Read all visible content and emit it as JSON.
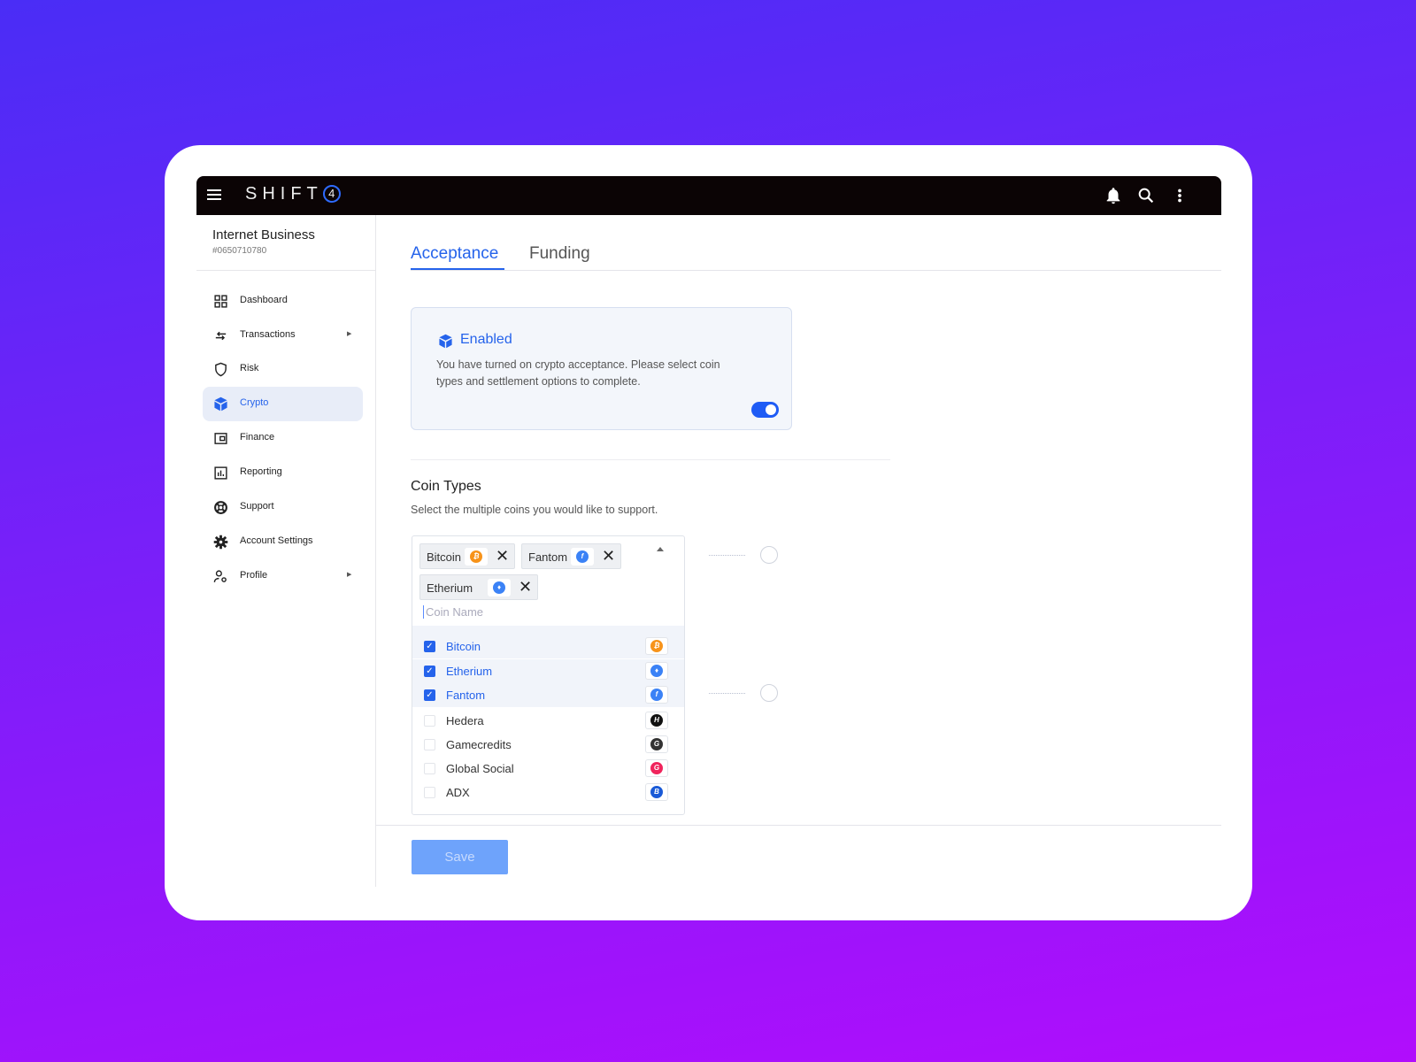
{
  "app": {
    "brand": "SHIFT",
    "brand_mark": "4"
  },
  "account": {
    "name": "Internet Business",
    "id": "#0650710780"
  },
  "sidebar": {
    "items": [
      {
        "label": "Dashboard",
        "icon": "grid-icon"
      },
      {
        "label": "Transactions",
        "icon": "arrows-icon",
        "has_submenu": true
      },
      {
        "label": "Risk",
        "icon": "shield-icon"
      },
      {
        "label": "Crypto",
        "icon": "cube-icon",
        "active": true
      },
      {
        "label": "Finance",
        "icon": "wallet-icon"
      },
      {
        "label": "Reporting",
        "icon": "bar-chart-icon"
      },
      {
        "label": "Support",
        "icon": "lifebuoy-icon"
      },
      {
        "label": "Account Settings",
        "icon": "gear-icon"
      },
      {
        "label": "Profile",
        "icon": "user-gear-icon",
        "has_submenu": true
      }
    ]
  },
  "tabs": [
    {
      "label": "Acceptance",
      "active": true
    },
    {
      "label": "Funding",
      "active": false
    }
  ],
  "status_card": {
    "title": "Enabled",
    "text": "You have turned on crypto acceptance. Please select coin types and settlement options to complete.",
    "toggle_on": true
  },
  "coin_types": {
    "title": "Coin Types",
    "subtitle": "Select the multiple coins you would like to support.",
    "selected_chips": [
      "Bitcoin",
      "Fantom",
      "Etherium"
    ],
    "search_placeholder": "Coin Name",
    "options": [
      {
        "label": "Bitcoin",
        "checked": true,
        "color": "#f7931a",
        "glyph": "₿"
      },
      {
        "label": "Etherium",
        "checked": true,
        "color": "#3b82f6",
        "glyph": "♦"
      },
      {
        "label": "Fantom",
        "checked": true,
        "color": "#3b82f6",
        "glyph": "f"
      },
      {
        "label": "Hedera",
        "checked": false,
        "color": "#111111",
        "glyph": "H"
      },
      {
        "label": "Gamecredits",
        "checked": false,
        "color": "#333333",
        "glyph": "G"
      },
      {
        "label": "Global Social",
        "checked": false,
        "color": "#f0245c",
        "glyph": "G"
      },
      {
        "label": "ADX",
        "checked": false,
        "color": "#1a5ad7",
        "glyph": "B"
      }
    ]
  },
  "save_label": "Save",
  "colors": {
    "accent": "#2563eb",
    "topbar": "#0b0405"
  }
}
